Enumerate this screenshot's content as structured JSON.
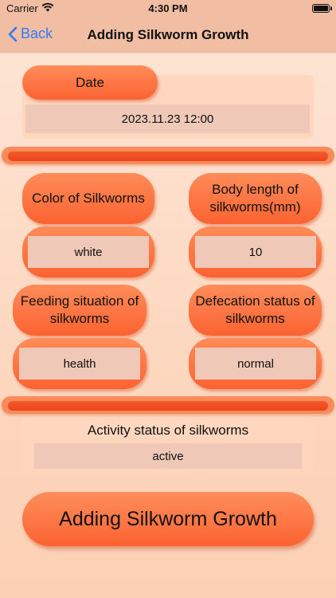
{
  "status_bar": {
    "carrier": "Carrier",
    "time": "4:30 PM"
  },
  "nav": {
    "back_label": "Back",
    "title": "Adding Silkworm Growth"
  },
  "form": {
    "date": {
      "label": "Date",
      "value": "2023.11.23 12:00"
    },
    "color": {
      "label": "Color of Silkworms",
      "value": "white"
    },
    "body_length": {
      "label": "Body length of silkworms(mm)",
      "value": "10"
    },
    "feeding": {
      "label": "Feeding situation of silkworms",
      "value": "health"
    },
    "defecation": {
      "label": "Defecation status of silkworms",
      "value": "normal"
    },
    "activity": {
      "label": "Activity status of silkworms",
      "value": "active"
    }
  },
  "submit_label": "Adding Silkworm Growth",
  "colors": {
    "accent": "#fb6331",
    "link": "#2f7cf6",
    "field": "#efc8b8"
  }
}
